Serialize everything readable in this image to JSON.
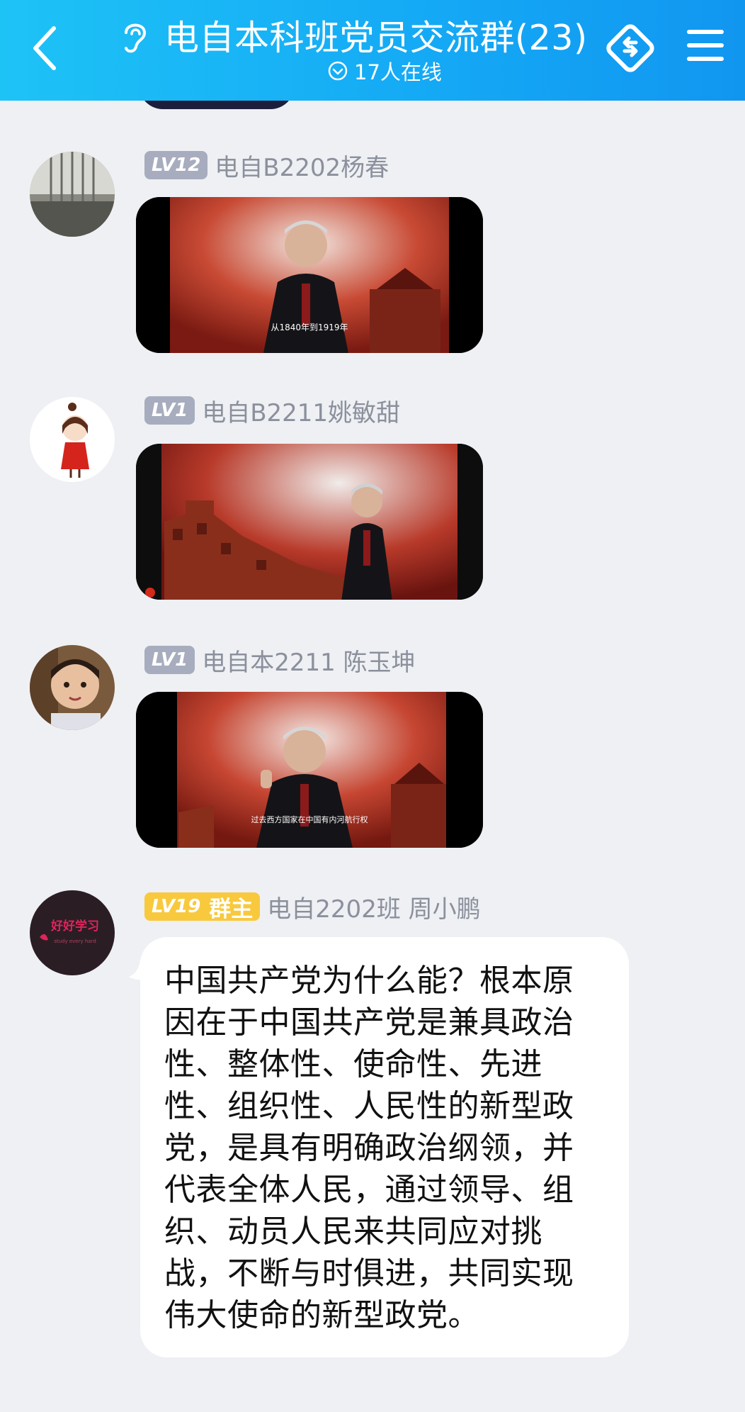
{
  "header": {
    "title": "电自本科班党员交流群(23)",
    "online": "17人在线",
    "icons": [
      "back-icon",
      "ear-icon",
      "online-check-icon",
      "share-icon",
      "menu-icon"
    ],
    "colors": {
      "gradient_start": "#1ec3f6",
      "gradient_end": "#1196f0"
    }
  },
  "messages": [
    {
      "level": "LV12",
      "sender": "电自B2202杨春",
      "type": "video",
      "subtitle": "从1840年到1919年"
    },
    {
      "level": "LV1",
      "sender": "电自B2211姚敏甜",
      "type": "video"
    },
    {
      "level": "LV1",
      "sender": "电自本2211  陈玉坤",
      "type": "video",
      "subtitle": "过去西方国家在中国有内河航行权"
    },
    {
      "level": "LV19",
      "role": "群主",
      "sender": "电自2202班  周小鹏",
      "type": "text",
      "text": "中国共产党为什么能？根本原因在于中国共产党是兼具政治性、整体性、使命性、先进性、组织性、人民性的新型政党，是具有明确政治纲领，并代表全体人民，通过领导、组织、动员人民来共同应对挑战，不断与时俱进，共同实现伟大使命的新型政党。"
    }
  ],
  "colors": {
    "background": "#eef0f4",
    "level_badge": "#a7adbe",
    "owner_badge": "#f9c93d",
    "sender_name": "#8b909c"
  }
}
